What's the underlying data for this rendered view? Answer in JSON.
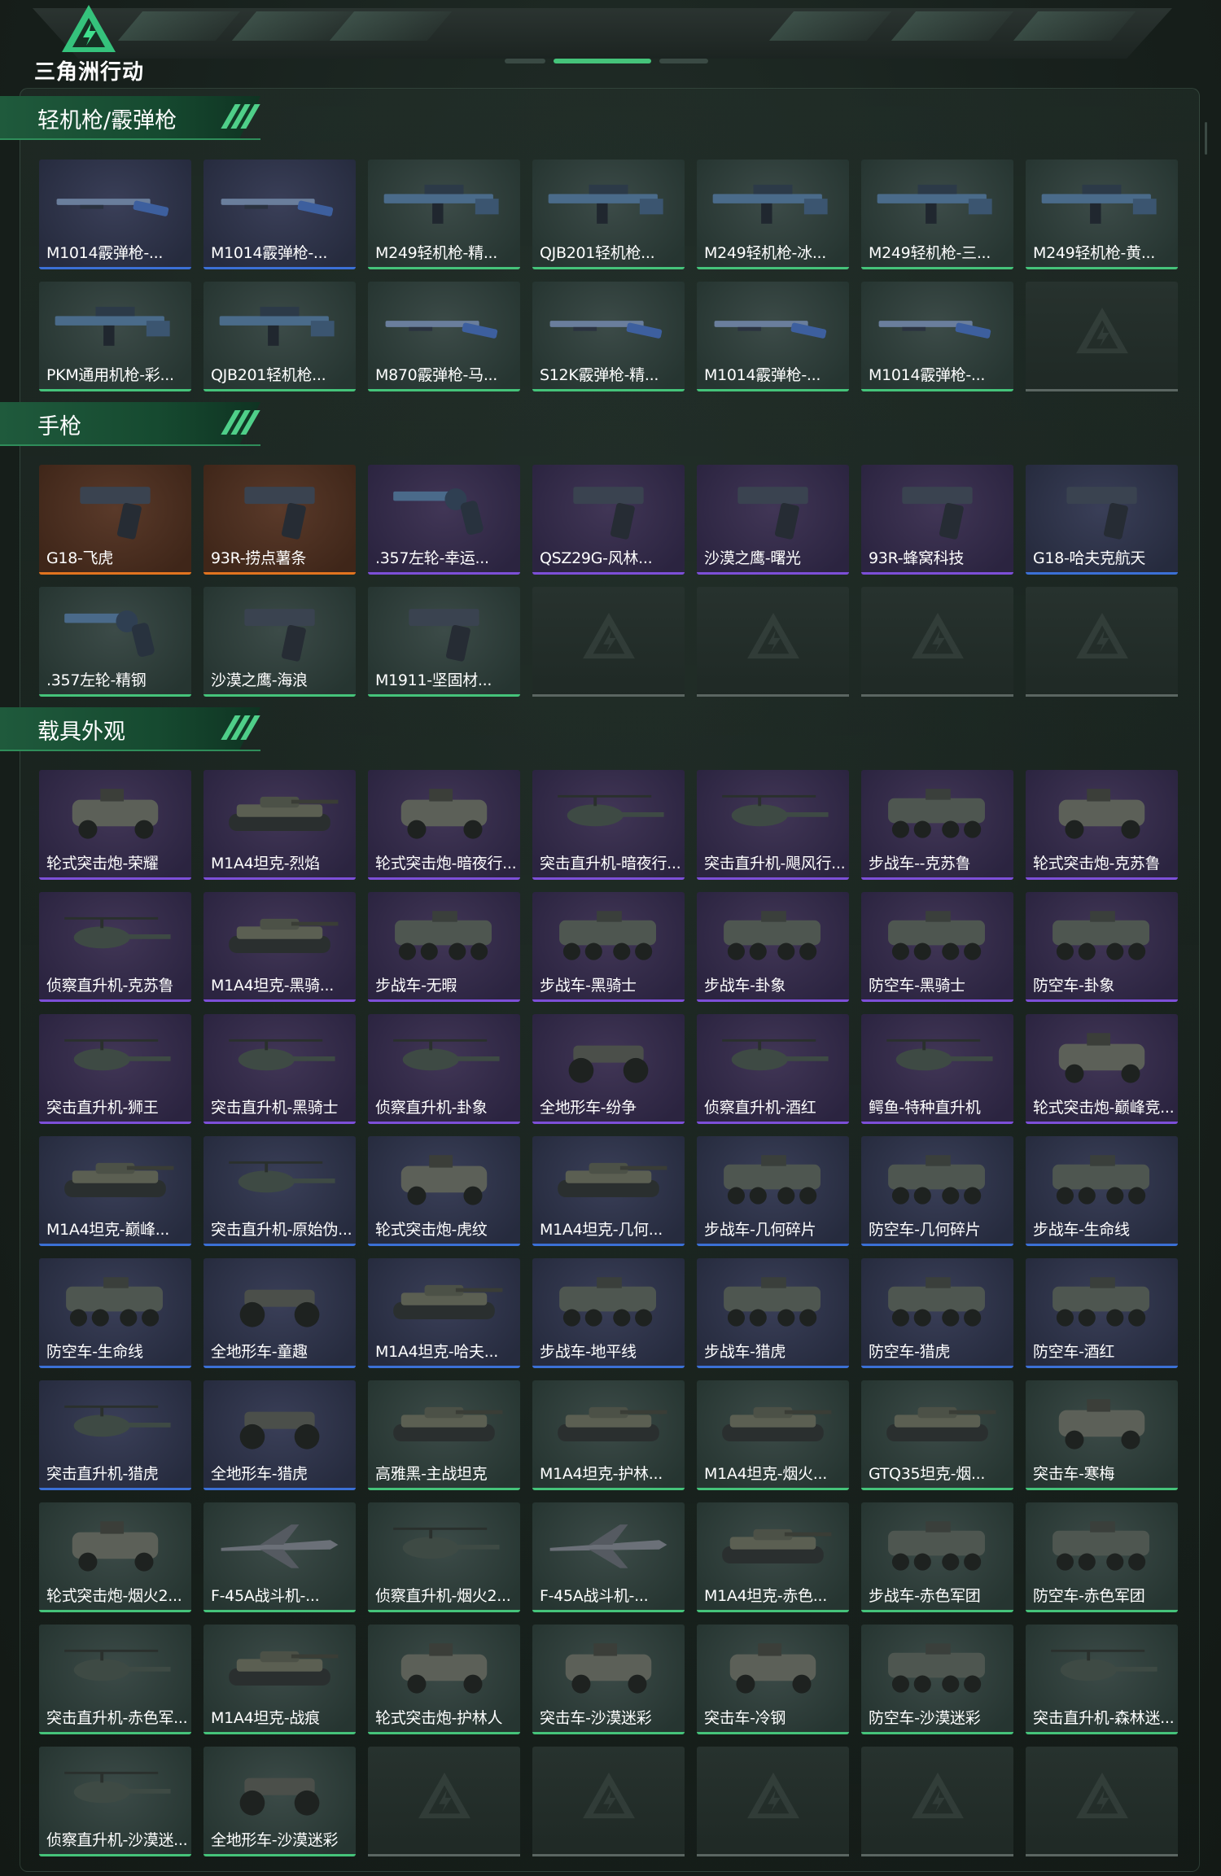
{
  "app": {
    "logo_text": "三角洲行动",
    "colors": {
      "green": "#45c37a",
      "blue": "#3b70d6",
      "purple": "#7d4fd8",
      "orange": "#e2741f"
    }
  },
  "sections": [
    {
      "title": "轻机枪/霰弹枪",
      "items": [
        {
          "name": "M1014霰弹枪-...",
          "rarity": "blue",
          "icon": "shotgun-icon"
        },
        {
          "name": "M1014霰弹枪-...",
          "rarity": "blue",
          "icon": "shotgun-icon"
        },
        {
          "name": "M249轻机枪-精...",
          "rarity": "green",
          "icon": "machine-gun-icon"
        },
        {
          "name": "QJB201轻机枪...",
          "rarity": "green",
          "icon": "machine-gun-icon"
        },
        {
          "name": "M249轻机枪-冰...",
          "rarity": "green",
          "icon": "machine-gun-icon"
        },
        {
          "name": "M249轻机枪-三...",
          "rarity": "green",
          "icon": "machine-gun-icon"
        },
        {
          "name": "M249轻机枪-黄...",
          "rarity": "green",
          "icon": "machine-gun-icon"
        },
        {
          "name": "PKM通用机枪-彩...",
          "rarity": "green",
          "icon": "machine-gun-icon"
        },
        {
          "name": "QJB201轻机枪...",
          "rarity": "green",
          "icon": "machine-gun-icon"
        },
        {
          "name": "M870霰弹枪-马...",
          "rarity": "green",
          "icon": "shotgun-icon"
        },
        {
          "name": "S12K霰弹枪-精...",
          "rarity": "green",
          "icon": "shotgun-icon"
        },
        {
          "name": "M1014霰弹枪-...",
          "rarity": "green",
          "icon": "shotgun-icon"
        },
        {
          "name": "M1014霰弹枪-...",
          "rarity": "green",
          "icon": "shotgun-icon"
        }
      ],
      "empty_slots": 1
    },
    {
      "title": "手枪",
      "items": [
        {
          "name": "G18-飞虎",
          "rarity": "orange",
          "icon": "pistol-icon"
        },
        {
          "name": "93R-捞点薯条",
          "rarity": "orange",
          "icon": "pistol-icon"
        },
        {
          "name": ".357左轮-幸运...",
          "rarity": "purple",
          "icon": "revolver-icon"
        },
        {
          "name": "QSZ29G-风林...",
          "rarity": "purple",
          "icon": "pistol-icon"
        },
        {
          "name": "沙漠之鹰-曙光",
          "rarity": "purple",
          "icon": "pistol-icon"
        },
        {
          "name": "93R-蜂窝科技",
          "rarity": "purple",
          "icon": "pistol-icon"
        },
        {
          "name": "G18-哈夫克航天",
          "rarity": "blue",
          "icon": "pistol-icon"
        },
        {
          "name": ".357左轮-精钢",
          "rarity": "green",
          "icon": "revolver-icon"
        },
        {
          "name": "沙漠之鹰-海浪",
          "rarity": "green",
          "icon": "pistol-icon"
        },
        {
          "name": "M1911-坚固材...",
          "rarity": "green",
          "icon": "pistol-icon"
        }
      ],
      "empty_slots": 4
    },
    {
      "title": "载具外观",
      "items": [
        {
          "name": "轮式突击炮-荣耀",
          "rarity": "purple",
          "icon": "armored-car-icon"
        },
        {
          "name": "M1A4坦克-烈焰",
          "rarity": "purple",
          "icon": "tank-icon"
        },
        {
          "name": "轮式突击炮-暗夜行...",
          "rarity": "purple",
          "icon": "armored-car-icon"
        },
        {
          "name": "突击直升机-暗夜行...",
          "rarity": "purple",
          "icon": "helicopter-icon"
        },
        {
          "name": "突击直升机-飓风行...",
          "rarity": "purple",
          "icon": "helicopter-icon"
        },
        {
          "name": "步战车--克苏鲁",
          "rarity": "purple",
          "icon": "ifv-icon"
        },
        {
          "name": "轮式突击炮-克苏鲁",
          "rarity": "purple",
          "icon": "armored-car-icon"
        },
        {
          "name": "侦察直升机-克苏鲁",
          "rarity": "purple",
          "icon": "helicopter-icon"
        },
        {
          "name": "M1A4坦克-黑骑...",
          "rarity": "purple",
          "icon": "tank-icon"
        },
        {
          "name": "步战车-无暇",
          "rarity": "purple",
          "icon": "ifv-icon"
        },
        {
          "name": "步战车-黑骑士",
          "rarity": "purple",
          "icon": "ifv-icon"
        },
        {
          "name": "步战车-卦象",
          "rarity": "purple",
          "icon": "ifv-icon"
        },
        {
          "name": "防空车-黑骑士",
          "rarity": "purple",
          "icon": "ifv-icon"
        },
        {
          "name": "防空车-卦象",
          "rarity": "purple",
          "icon": "ifv-icon"
        },
        {
          "name": "突击直升机-狮王",
          "rarity": "purple",
          "icon": "helicopter-icon"
        },
        {
          "name": "突击直升机-黑骑士",
          "rarity": "purple",
          "icon": "helicopter-icon"
        },
        {
          "name": "侦察直升机-卦象",
          "rarity": "purple",
          "icon": "helicopter-icon"
        },
        {
          "name": "全地形车-纷争",
          "rarity": "purple",
          "icon": "atv-icon"
        },
        {
          "name": "侦察直升机-酒红",
          "rarity": "purple",
          "icon": "helicopter-icon"
        },
        {
          "name": "鳄鱼-特种直升机",
          "rarity": "purple",
          "icon": "helicopter-icon"
        },
        {
          "name": "轮式突击炮-巅峰竞...",
          "rarity": "purple",
          "icon": "armored-car-icon"
        },
        {
          "name": "M1A4坦克-巅峰...",
          "rarity": "blue",
          "icon": "tank-icon"
        },
        {
          "name": "突击直升机-原始伪...",
          "rarity": "blue",
          "icon": "helicopter-icon"
        },
        {
          "name": "轮式突击炮-虎纹",
          "rarity": "blue",
          "icon": "armored-car-icon"
        },
        {
          "name": "M1A4坦克-几何...",
          "rarity": "blue",
          "icon": "tank-icon"
        },
        {
          "name": "步战车-几何碎片",
          "rarity": "blue",
          "icon": "ifv-icon"
        },
        {
          "name": "防空车-几何碎片",
          "rarity": "blue",
          "icon": "ifv-icon"
        },
        {
          "name": "步战车-生命线",
          "rarity": "blue",
          "icon": "ifv-icon"
        },
        {
          "name": "防空车-生命线",
          "rarity": "blue",
          "icon": "ifv-icon"
        },
        {
          "name": "全地形车-童趣",
          "rarity": "blue",
          "icon": "atv-icon"
        },
        {
          "name": "M1A4坦克-哈夫...",
          "rarity": "blue",
          "icon": "tank-icon"
        },
        {
          "name": "步战车-地平线",
          "rarity": "blue",
          "icon": "ifv-icon"
        },
        {
          "name": "步战车-猎虎",
          "rarity": "blue",
          "icon": "ifv-icon"
        },
        {
          "name": "防空车-猎虎",
          "rarity": "blue",
          "icon": "ifv-icon"
        },
        {
          "name": "防空车-酒红",
          "rarity": "blue",
          "icon": "ifv-icon"
        },
        {
          "name": "突击直升机-猎虎",
          "rarity": "blue",
          "icon": "helicopter-icon"
        },
        {
          "name": "全地形车-猎虎",
          "rarity": "blue",
          "icon": "atv-icon"
        },
        {
          "name": "高雅黑-主战坦克",
          "rarity": "green",
          "icon": "tank-icon"
        },
        {
          "name": "M1A4坦克-护林...",
          "rarity": "green",
          "icon": "tank-icon"
        },
        {
          "name": "M1A4坦克-烟火...",
          "rarity": "green",
          "icon": "tank-icon"
        },
        {
          "name": "GTQ35坦克-烟...",
          "rarity": "green",
          "icon": "tank-icon"
        },
        {
          "name": "突击车-寒梅",
          "rarity": "green",
          "icon": "armored-car-icon"
        },
        {
          "name": "轮式突击炮-烟火2...",
          "rarity": "green",
          "icon": "armored-car-icon"
        },
        {
          "name": "F-45A战斗机-...",
          "rarity": "green",
          "icon": "jet-icon"
        },
        {
          "name": "侦察直升机-烟火2...",
          "rarity": "green",
          "icon": "helicopter-icon"
        },
        {
          "name": "F-45A战斗机-...",
          "rarity": "green",
          "icon": "jet-icon"
        },
        {
          "name": "M1A4坦克-赤色...",
          "rarity": "green",
          "icon": "tank-icon"
        },
        {
          "name": "步战车-赤色军团",
          "rarity": "green",
          "icon": "ifv-icon"
        },
        {
          "name": "防空车-赤色军团",
          "rarity": "green",
          "icon": "ifv-icon"
        },
        {
          "name": "突击直升机-赤色军...",
          "rarity": "green",
          "icon": "helicopter-icon"
        },
        {
          "name": "M1A4坦克-战痕",
          "rarity": "green",
          "icon": "tank-icon"
        },
        {
          "name": "轮式突击炮-护林人",
          "rarity": "green",
          "icon": "armored-car-icon"
        },
        {
          "name": "突击车-沙漠迷彩",
          "rarity": "green",
          "icon": "armored-car-icon"
        },
        {
          "name": "突击车-冷钢",
          "rarity": "green",
          "icon": "armored-car-icon"
        },
        {
          "name": "防空车-沙漠迷彩",
          "rarity": "green",
          "icon": "ifv-icon"
        },
        {
          "name": "突击直升机-森林迷...",
          "rarity": "green",
          "icon": "helicopter-icon"
        },
        {
          "name": "侦察直升机-沙漠迷...",
          "rarity": "green",
          "icon": "helicopter-icon"
        },
        {
          "name": "全地形车-沙漠迷彩",
          "rarity": "green",
          "icon": "atv-icon"
        }
      ],
      "empty_slots": 5
    }
  ]
}
